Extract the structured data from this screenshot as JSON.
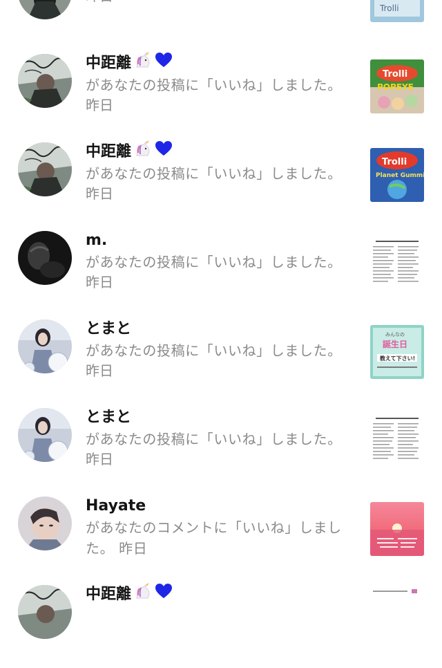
{
  "notifications": [
    {
      "name": "",
      "message": "",
      "time": "昨日",
      "avatar": "graffiti-avatar",
      "thumbnail": "candy-thumbnail-blue"
    },
    {
      "name": "中距離",
      "message": "があなたの投稿に「いいね」しました。",
      "time": "昨日",
      "avatar": "graffiti-avatar",
      "thumbnail": "trolli-popeye-thumbnail",
      "thumbnail_text": "Trolli POPEYE"
    },
    {
      "name": "中距離",
      "message": "があなたの投稿に「いいね」しました。",
      "time": "昨日",
      "avatar": "graffiti-avatar",
      "thumbnail": "trolli-planet-gummi-thumbnail",
      "thumbnail_text": "Trolli Planet Gummi"
    },
    {
      "name": "m.",
      "message": "があなたの投稿に「いいね」しました。",
      "time": "昨日",
      "avatar": "dark-avatar",
      "thumbnail": "text-list-thumbnail",
      "thumbnail_text": "いいねの数だけ自己紹介する"
    },
    {
      "name": "とまと",
      "message": "があなたの投稿に「いいね」しました。",
      "time": "昨日",
      "avatar": "girl-avatar",
      "thumbnail": "birthday-card-thumbnail",
      "thumbnail_text": "みんなの誕生日教えて下さい!"
    },
    {
      "name": "とまと",
      "message": "があなたの投稿に「いいね」しました。",
      "time": "昨日",
      "avatar": "girl-avatar",
      "thumbnail": "text-list-thumbnail",
      "thumbnail_text": "いいねの数だけ自己紹介する"
    },
    {
      "name": "Hayate",
      "message": "があなたのコメントに「いいね」しました。",
      "time": "昨日",
      "avatar": "portrait-avatar",
      "thumbnail": "sunset-thumbnail"
    },
    {
      "name": "中距離",
      "message": "",
      "time": "",
      "avatar": "graffiti-avatar",
      "thumbnail": "text-list-thumbnail"
    }
  ],
  "colors": {
    "name_text": "#151515",
    "secondary_text": "#8a8a8a",
    "heart": "#1f27e6",
    "background": "#ffffff"
  },
  "emoji": [
    "unicorn-icon",
    "blue-heart-icon"
  ]
}
